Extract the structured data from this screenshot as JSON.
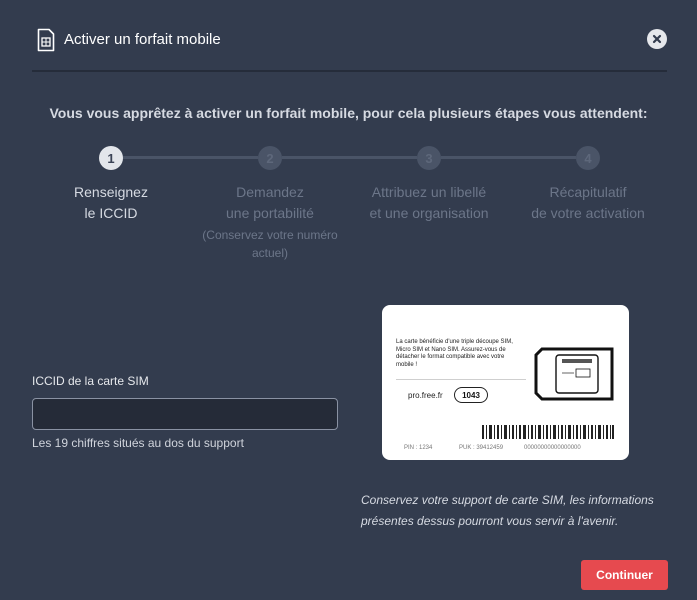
{
  "header": {
    "title": "Activer un forfait mobile",
    "close_icon": "close-icon",
    "sim_icon": "sim-card-icon"
  },
  "intro": "Vous vous apprêtez à activer un forfait mobile, pour cela plusieurs étapes vous attendent:",
  "steps": [
    {
      "number": "1",
      "line1": "Renseignez",
      "line2": "le ICCID",
      "note": "",
      "active": true
    },
    {
      "number": "2",
      "line1": "Demandez",
      "line2": "une portabilité",
      "note": "(Conservez votre numéro actuel)",
      "active": false
    },
    {
      "number": "3",
      "line1": "Attribuez un libellé",
      "line2": "et une organisation",
      "note": "",
      "active": false
    },
    {
      "number": "4",
      "line1": "Récapitulatif",
      "line2": "de votre activation",
      "note": "",
      "active": false
    }
  ],
  "form": {
    "iccid_label": "ICCID de la carte SIM",
    "iccid_value": "",
    "iccid_placeholder": "",
    "iccid_help": "Les 19 chiffres situés au dos du support"
  },
  "sim_card": {
    "description": "La carte bénéficie d'une triple découpe SIM, Micro SIM et Nano SIM. Assurez-vous de détacher le format compatible avec votre mobile !",
    "website": "pro.free.fr",
    "support_number": "1043",
    "pin_label": "PIN : 1234",
    "puk_label": "PUK : 39412459",
    "serial": "00000000000000000"
  },
  "sim_note": "Conservez votre support de carte SIM, les informations présentes dessus pourront vous servir à l'avenir.",
  "actions": {
    "continue_label": "Continuer"
  },
  "colors": {
    "background": "#333c4e",
    "accent": "#e64a4f",
    "step_active": "#e3e6eb",
    "step_inactive": "#4a5467"
  }
}
